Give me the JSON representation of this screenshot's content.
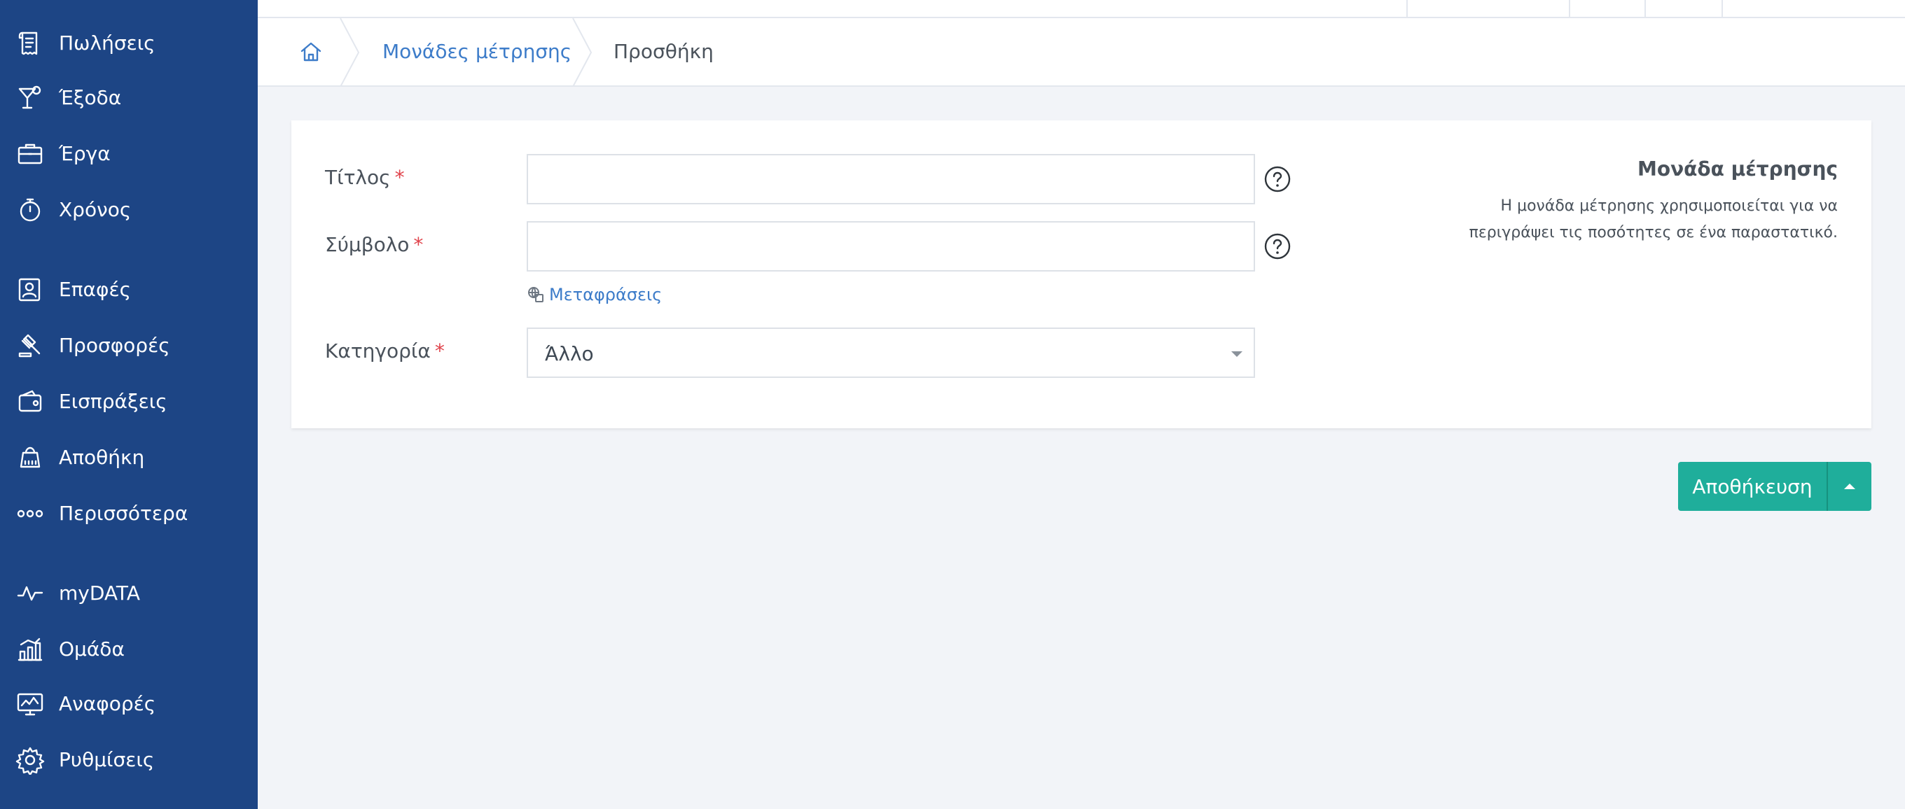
{
  "sidebar": {
    "items": [
      {
        "label": "Πωλήσεις",
        "icon": "receipt-icon"
      },
      {
        "label": "Έξοδα",
        "icon": "cocktail-icon"
      },
      {
        "label": "Έργα",
        "icon": "briefcase-icon"
      },
      {
        "label": "Χρόνος",
        "icon": "stopwatch-icon"
      },
      {
        "label": "Επαφές",
        "icon": "contact-card-icon"
      },
      {
        "label": "Προσφορές",
        "icon": "gavel-icon"
      },
      {
        "label": "Εισπράξεις",
        "icon": "wallet-icon"
      },
      {
        "label": "Αποθήκη",
        "icon": "scale-icon"
      },
      {
        "label": "Περισσότερα",
        "icon": "more-dots-icon"
      },
      {
        "label": "myDATA",
        "icon": "pulse-icon"
      },
      {
        "label": "Ομάδα",
        "icon": "team-chart-icon"
      },
      {
        "label": "Αναφορές",
        "icon": "reports-monitor-icon"
      },
      {
        "label": "Ρυθμίσεις",
        "icon": "gear-icon"
      }
    ]
  },
  "breadcrumb": {
    "home_icon": "home-icon",
    "parent": "Μονάδες μέτρησης",
    "current": "Προσθήκη"
  },
  "form": {
    "title": {
      "label": "Τίτλος",
      "required_mark": "*",
      "value": ""
    },
    "symbol": {
      "label": "Σύμβολο",
      "required_mark": "*",
      "value": ""
    },
    "translations_link": "Μεταφράσεις",
    "category": {
      "label": "Κατηγορία",
      "required_mark": "*",
      "selected": "Άλλο"
    }
  },
  "info": {
    "title": "Μονάδα μέτρησης",
    "text": "Η μονάδα μέτρησης χρησιμοποιείται για να περιγράψει τις ποσότητες σε ένα παραστατικό."
  },
  "actions": {
    "save_label": "Αποθήκευση"
  },
  "colors": {
    "sidebar_bg": "#1d4585",
    "link": "#3d7cc9",
    "primary_button": "#1fae9b",
    "required": "#e0434b"
  }
}
